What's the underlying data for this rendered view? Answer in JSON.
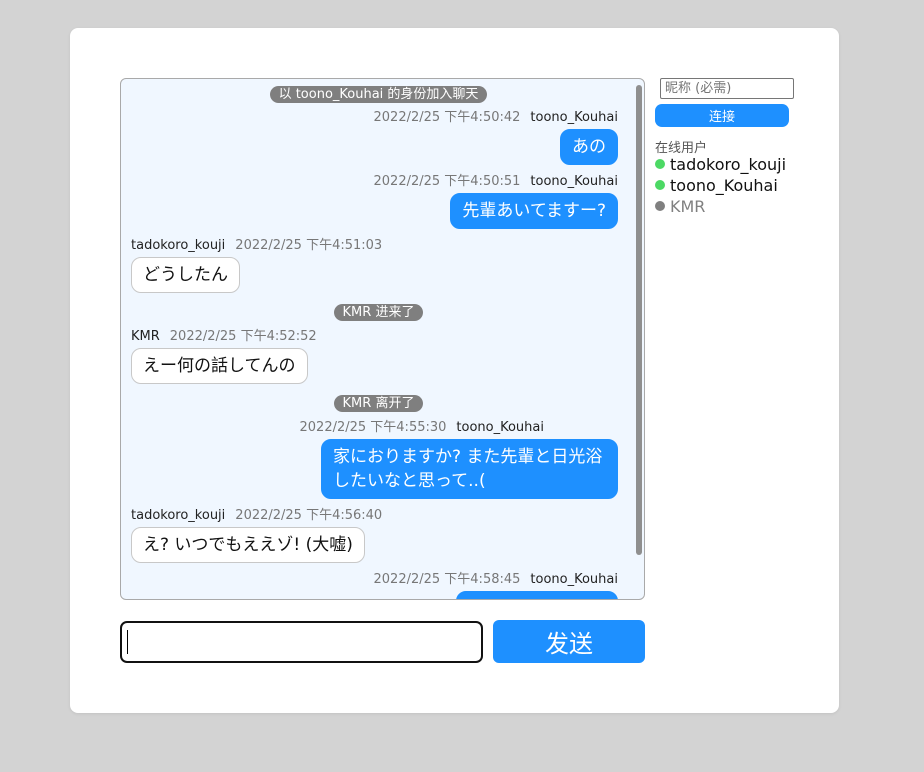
{
  "colors": {
    "accent": "#1e90ff",
    "online": "#4cd964",
    "offline": "#808080",
    "system_badge": "#7f7f7f"
  },
  "chat": {
    "system_join": "以 toono_Kouhai 的身份加入聊天",
    "messages": [
      {
        "type": "mine",
        "user": "toono_Kouhai",
        "time": "2022/2/25 下午4:50:42",
        "text": "あの"
      },
      {
        "type": "mine",
        "user": "toono_Kouhai",
        "time": "2022/2/25 下午4:50:51",
        "text": "先輩あいてますー?"
      },
      {
        "type": "other",
        "user": "tadokoro_kouji",
        "time": "2022/2/25 下午4:51:03",
        "text": "どうしたん"
      },
      {
        "type": "system",
        "text": "KMR 进来了"
      },
      {
        "type": "other",
        "user": "KMR",
        "time": "2022/2/25 下午4:52:52",
        "text": "えー何の話してんの"
      },
      {
        "type": "system",
        "text": "KMR 离开了"
      },
      {
        "type": "mine",
        "user": "toono_Kouhai",
        "time": "2022/2/25 下午4:55:30",
        "text": "家におりますか? また先輩と日光浴したいなと思って..("
      },
      {
        "type": "other",
        "user": "tadokoro_kouji",
        "time": "2022/2/25 下午4:56:40",
        "text": "え? いつでもええゾ! (大嘘)"
      },
      {
        "type": "mine",
        "user": "toono_Kouhai",
        "time": "2022/2/25 下午4:58:45",
        "text": ""
      }
    ]
  },
  "composer": {
    "input_value": "",
    "send_label": "发送"
  },
  "sidebar": {
    "nickname_placeholder": "昵称 (必需)",
    "connect_label": "连接",
    "online_title": "在线用户",
    "users": [
      {
        "name": "tadokoro_kouji",
        "status": "online"
      },
      {
        "name": "toono_Kouhai",
        "status": "online"
      },
      {
        "name": "KMR",
        "status": "offline"
      }
    ]
  }
}
